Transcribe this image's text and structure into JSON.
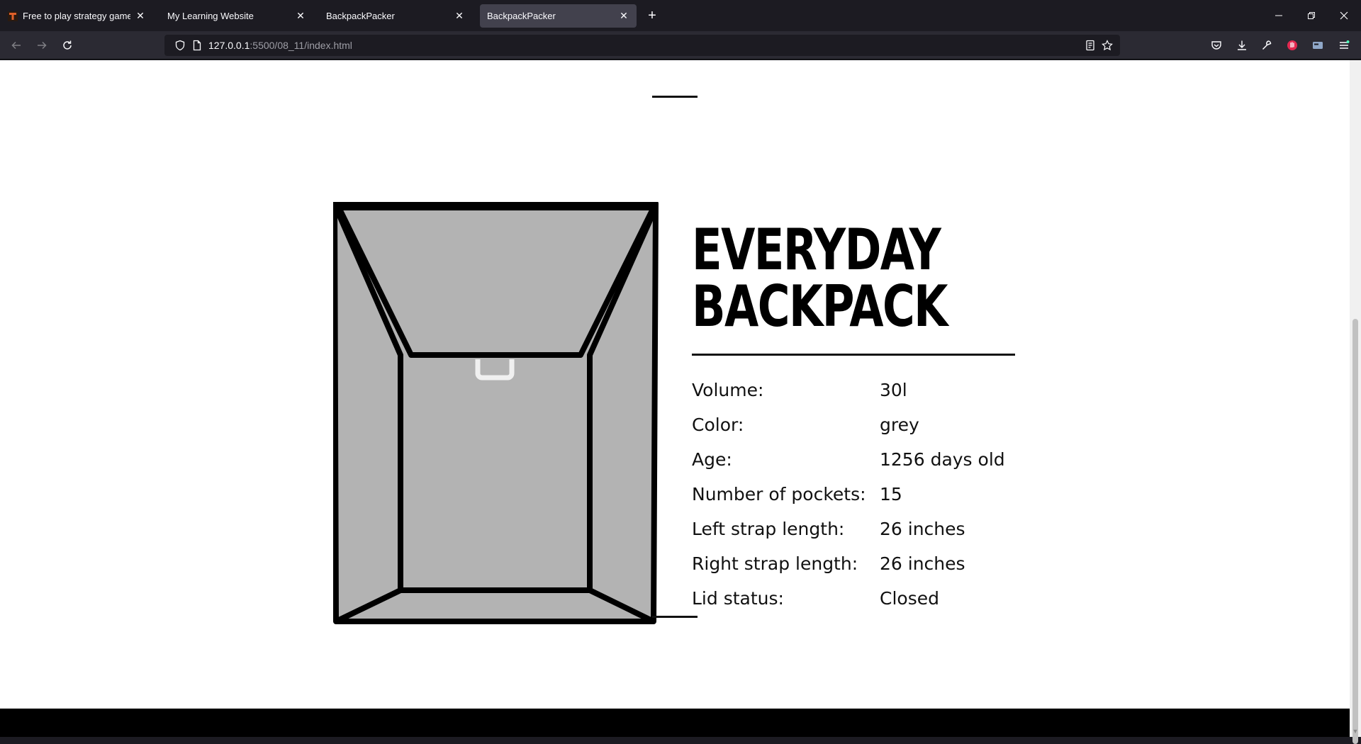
{
  "browser": {
    "tabs": [
      {
        "title": "Free to play strategy game online",
        "active": false,
        "favicon": "strategy-game-favicon"
      },
      {
        "title": "My Learning Website",
        "active": false,
        "favicon": ""
      },
      {
        "title": "BackpackPacker",
        "active": false,
        "favicon": ""
      },
      {
        "title": "BackpackPacker",
        "active": true,
        "favicon": ""
      }
    ],
    "url": {
      "host": "127.0.0.1",
      "rest": ":5500/08_11/index.html"
    },
    "icons": {
      "back": "back-arrow-icon",
      "forward": "forward-arrow-icon",
      "reload": "reload-icon",
      "shield": "shield-icon",
      "page": "page-icon",
      "reader": "reader-view-icon",
      "bookmark": "star-icon",
      "pocket": "pocket-icon",
      "downloads": "download-icon",
      "tools": "wrench-icon",
      "extension": "extension-icon",
      "account": "account-card-icon",
      "menu": "hamburger-menu-icon"
    }
  },
  "page": {
    "title_line1": "EVERYDAY",
    "title_line2": "BACKPACK",
    "properties": [
      {
        "label": "Volume:",
        "value": "30l"
      },
      {
        "label": "Color:",
        "value": "grey"
      },
      {
        "label": "Age:",
        "value": "1256 days old"
      },
      {
        "label": "Number of pockets:",
        "value": "15"
      },
      {
        "label": "Left strap length:",
        "value": "26 inches"
      },
      {
        "label": "Right strap length:",
        "value": "26 inches"
      },
      {
        "label": "Lid status:",
        "value": "Closed"
      }
    ]
  },
  "colors": {
    "chrome_dark": "#1c1b22",
    "chrome_toolbar": "#2b2a33",
    "active_tab": "#42414d",
    "backpack_fill": "#b3b3b3",
    "ink": "#000000"
  }
}
